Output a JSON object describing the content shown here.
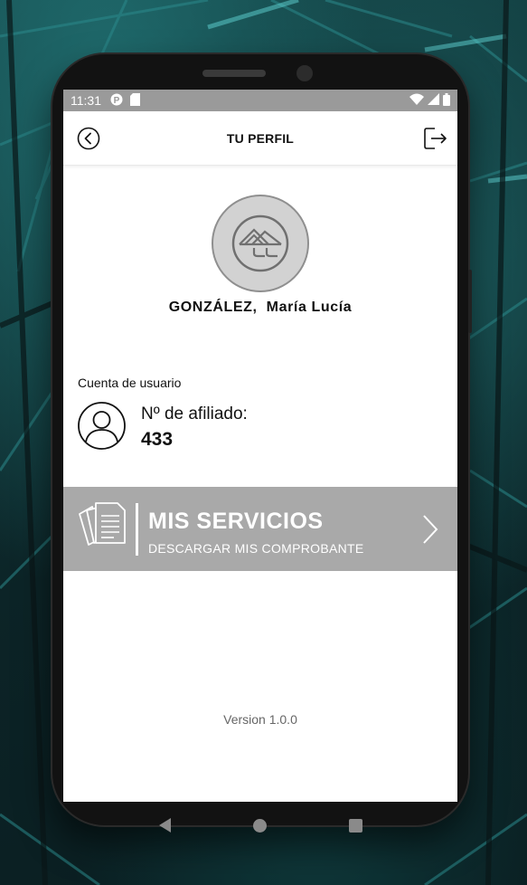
{
  "status_bar": {
    "time": "11:31",
    "icons": [
      "notification-p-icon",
      "sd-card-icon",
      "wifi-icon",
      "signal-icon",
      "battery-icon"
    ]
  },
  "app_bar": {
    "title": "TU PERFIL",
    "back_icon": "chevron-left-circle-icon",
    "logout_icon": "logout-icon"
  },
  "profile": {
    "avatar_icon": "company-logo",
    "name": "GONZÁLEZ,  María Lucía"
  },
  "account": {
    "section_label": "Cuenta de usuario",
    "afiliado_label": "Nº de afiliado:",
    "afiliado_number": "433"
  },
  "services": {
    "title": "MIS SERVICIOS",
    "subtitle": "DESCARGAR MIS COMPROBANTE",
    "background_color": "#a9a9a9"
  },
  "footer": {
    "version": "Version 1.0.0"
  },
  "colors": {
    "status_bar": "#9a9a9a",
    "accent_gray": "#a9a9a9",
    "text": "#111111"
  }
}
